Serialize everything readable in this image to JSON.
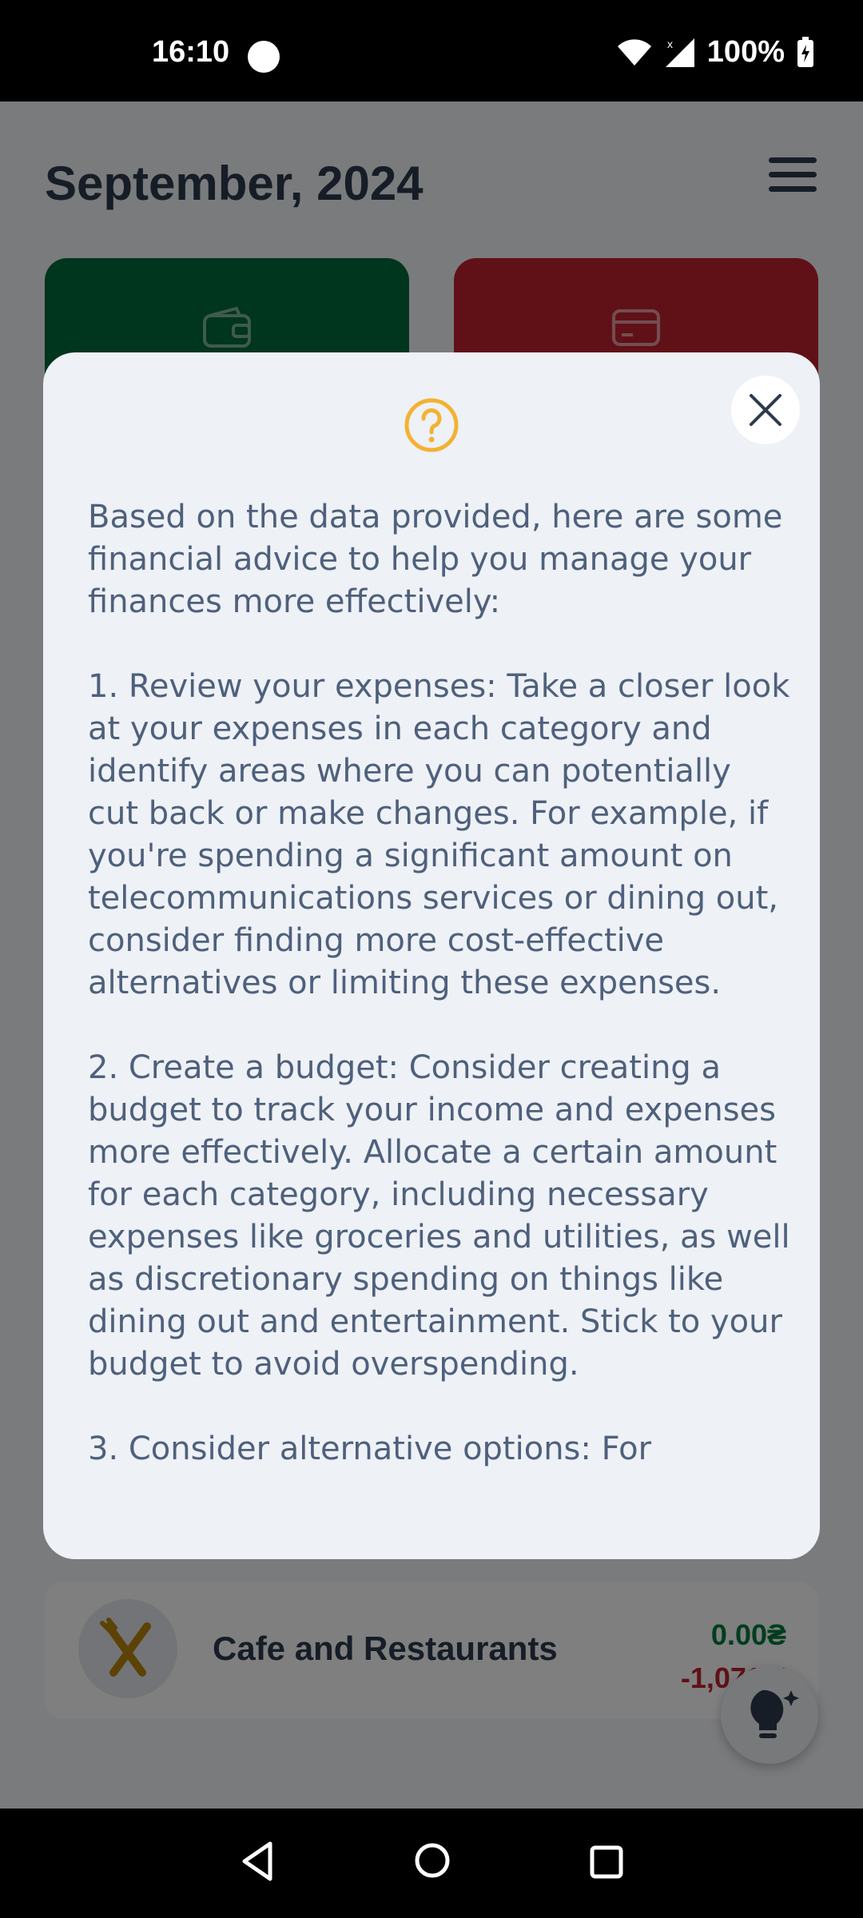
{
  "status_bar": {
    "time": "16:10",
    "battery": "100%"
  },
  "header": {
    "title": "September, 2024"
  },
  "category_row": {
    "name": "Cafe and Restaurants",
    "budget": "0.00₴",
    "spent": "-1,071.5"
  },
  "dialog": {
    "advice_text": "Based on the data provided, here are some financial advice to help you manage your finances more effectively:\n\n1. Review your expenses: Take a closer look at your expenses in each category and identify areas where you can potentially cut back or make changes. For example, if you're spending a significant amount on telecommunications services or dining out, consider finding more cost-effective alternatives or limiting these expenses.\n\n2. Create a budget: Consider creating a budget to track your income and expenses more effectively. Allocate a certain amount for each category, including necessary expenses like groceries and utilities, as well as discretionary spending on things like dining out and entertainment. Stick to your budget to avoid overspending.\n\n3. Consider alternative options: For"
  },
  "colors": {
    "income_card": "#006b3c",
    "expense_card": "#c0222e",
    "help_icon": "#f2b233",
    "title": "#2d3a4e"
  },
  "icons": {
    "income": "wallet-icon",
    "expense": "credit-card-icon",
    "help": "question-circle-icon",
    "close": "close-icon",
    "category": "fork-knife-icon",
    "fab": "lightbulb-sparkle-icon"
  }
}
